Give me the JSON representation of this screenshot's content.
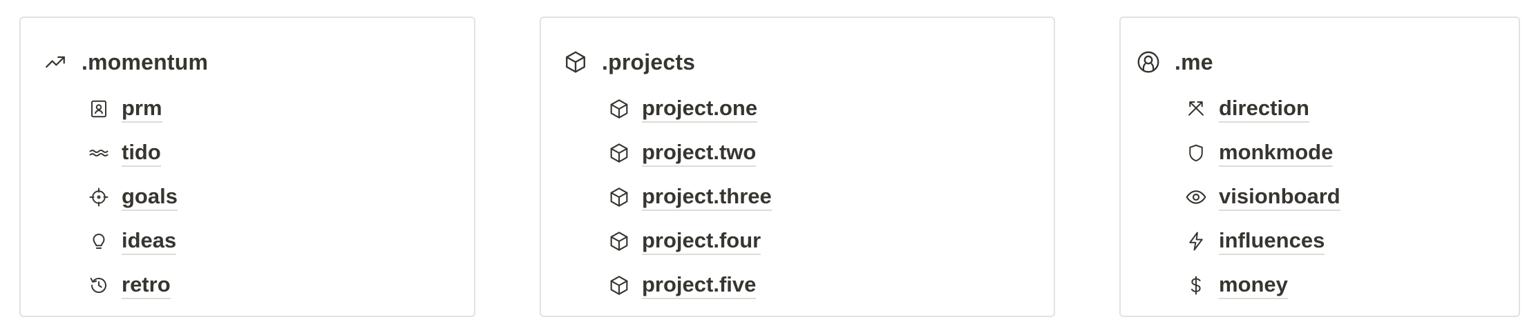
{
  "cards": [
    {
      "title": ".momentum",
      "icon": "trending-up-icon",
      "items": [
        {
          "label": "prm",
          "icon": "contact-book-icon"
        },
        {
          "label": "tido",
          "icon": "waves-icon"
        },
        {
          "label": "goals",
          "icon": "crosshair-icon"
        },
        {
          "label": "ideas",
          "icon": "lightbulb-icon"
        },
        {
          "label": "retro",
          "icon": "history-icon"
        }
      ]
    },
    {
      "title": ".projects",
      "icon": "box-icon",
      "items": [
        {
          "label": "project.one",
          "icon": "box-icon"
        },
        {
          "label": "project.two",
          "icon": "box-icon"
        },
        {
          "label": "project.three",
          "icon": "box-icon"
        },
        {
          "label": "project.four",
          "icon": "box-icon"
        },
        {
          "label": "project.five",
          "icon": "box-icon"
        }
      ]
    },
    {
      "title": ".me",
      "icon": "user-circle-icon",
      "items": [
        {
          "label": "direction",
          "icon": "crossed-axes-icon"
        },
        {
          "label": "monkmode",
          "icon": "shield-icon"
        },
        {
          "label": "visionboard",
          "icon": "eye-icon"
        },
        {
          "label": "influences",
          "icon": "lightning-icon"
        },
        {
          "label": "money",
          "icon": "dollar-icon"
        }
      ]
    }
  ],
  "colors": {
    "text": "#37352f",
    "border": "#e3e2e0",
    "underline": "#dcdbd8"
  }
}
